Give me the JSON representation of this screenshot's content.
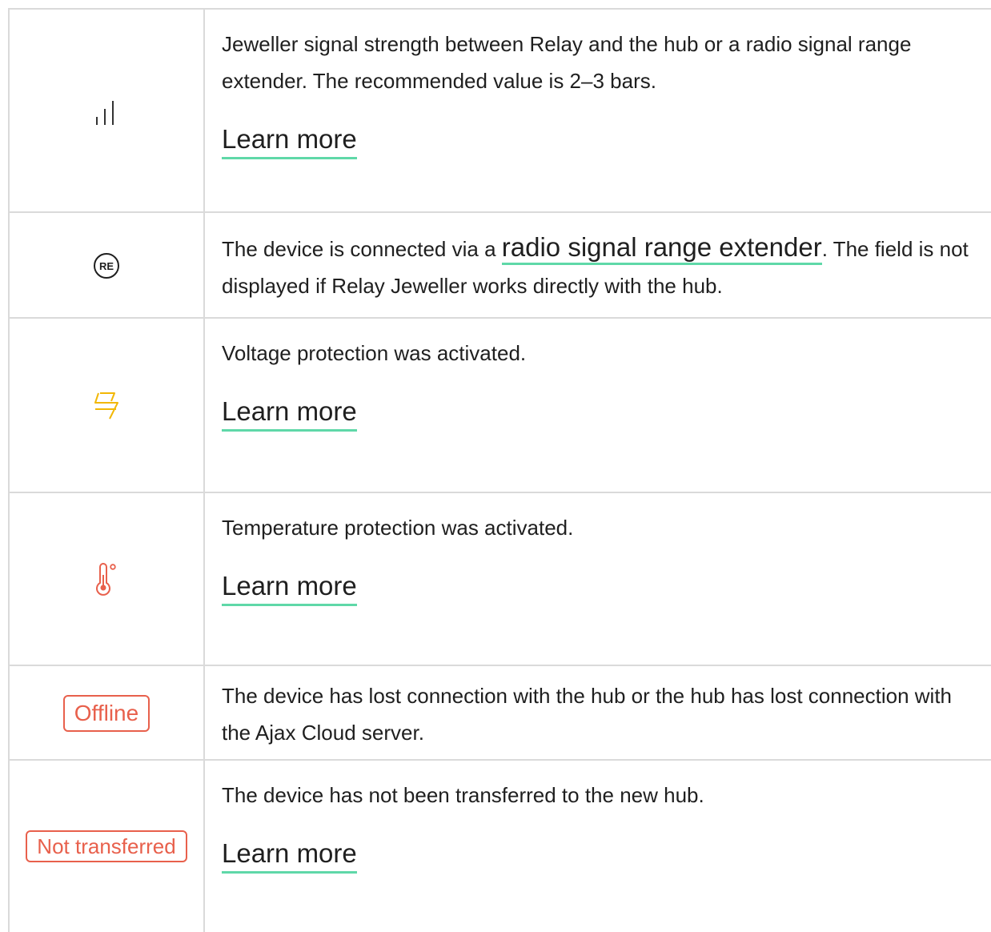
{
  "rows": [
    {
      "icon": "signal-bars-icon",
      "text": "Jeweller signal strength between Relay and the hub or a radio signal range extender. The recommended value is 2–3 bars.",
      "link": "Learn more"
    },
    {
      "icon": "re-icon",
      "icon_text": "RE",
      "text_before": "The device is connected via a ",
      "link_inline": "radio signal range extender",
      "text_after": ". The field is not displayed if Relay Jeweller works directly with the hub."
    },
    {
      "icon": "voltage-protection-icon",
      "icon_color": "#f2b705",
      "text": "Voltage protection was activated.",
      "link": "Learn more"
    },
    {
      "icon": "temperature-icon",
      "icon_color": "#e8604c",
      "text": "Temperature protection was activated.",
      "link": "Learn more"
    },
    {
      "badge": "Offline",
      "badge_color": "#e8604c",
      "text": "The device has lost connection with the hub or the hub has lost connection with the Ajax Cloud server."
    },
    {
      "badge": "Not transferred",
      "badge_color": "#e8604c",
      "text": "The device has not been transferred to the new hub.",
      "link": "Learn more"
    }
  ]
}
